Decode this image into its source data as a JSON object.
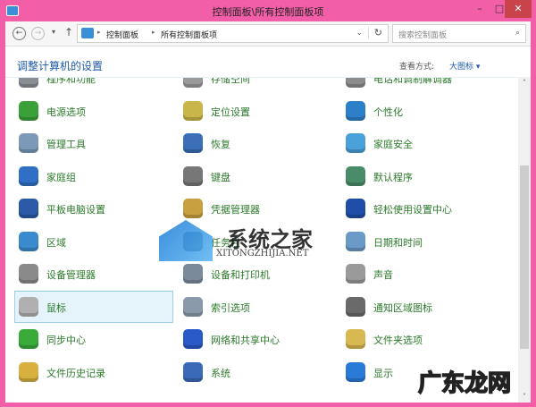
{
  "window": {
    "title": "控制面板\\所有控制面板项",
    "minimize": "–",
    "maximize": "□",
    "close": "✕"
  },
  "nav": {
    "back": "←",
    "forward": "→",
    "dropdown": "▾",
    "up": "↑",
    "breadcrumb": [
      "控制面板",
      "所有控制面板项"
    ],
    "sep": "▸",
    "addr_dropdown": "⌄",
    "refresh": "↻",
    "search_placeholder": "搜索控制面板",
    "search_icon": "⌕"
  },
  "header": {
    "title": "调整计算机的设置",
    "view_by_label": "查看方式:",
    "view_by_value": "大图标 ▾"
  },
  "items": [
    {
      "label": "程序和功能",
      "color": "#8a8f96"
    },
    {
      "label": "存储空间",
      "color": "#9a9a9a"
    },
    {
      "label": "电话和调制解调器",
      "color": "#8c8c8c"
    },
    {
      "label": "电源选项",
      "color": "#3aa13a"
    },
    {
      "label": "定位设置",
      "color": "#c9b64a"
    },
    {
      "label": "个性化",
      "color": "#2e7fc9"
    },
    {
      "label": "管理工具",
      "color": "#7c9ab8"
    },
    {
      "label": "恢复",
      "color": "#3b6fb8"
    },
    {
      "label": "家庭安全",
      "color": "#4aa0d8"
    },
    {
      "label": "家庭组",
      "color": "#2f6fc6"
    },
    {
      "label": "键盘",
      "color": "#777777"
    },
    {
      "label": "默认程序",
      "color": "#4a8c6a"
    },
    {
      "label": "平板电脑设置",
      "color": "#2a5aa8"
    },
    {
      "label": "凭据管理器",
      "color": "#c8a040"
    },
    {
      "label": "轻松使用设置中心",
      "color": "#1e4ea8"
    },
    {
      "label": "区域",
      "color": "#3a8ad0"
    },
    {
      "label": "任务栏",
      "color": "#5a7a9a"
    },
    {
      "label": "日期和时间",
      "color": "#6a9ac8"
    },
    {
      "label": "设备管理器",
      "color": "#8a8a8a"
    },
    {
      "label": "设备和打印机",
      "color": "#7a8a9a"
    },
    {
      "label": "声音",
      "color": "#9a9a9a"
    },
    {
      "label": "鼠标",
      "color": "#b0b0b0",
      "selected": true
    },
    {
      "label": "索引选项",
      "color": "#8a9aaa"
    },
    {
      "label": "通知区域图标",
      "color": "#6a6a6a"
    },
    {
      "label": "同步中心",
      "color": "#3aaa3a"
    },
    {
      "label": "网络和共享中心",
      "color": "#2a5ac8"
    },
    {
      "label": "文件夹选项",
      "color": "#d8b850"
    },
    {
      "label": "文件历史记录",
      "color": "#d8b040"
    },
    {
      "label": "系统",
      "color": "#3a6ab8"
    },
    {
      "label": "显示",
      "color": "#2a7ad8"
    }
  ],
  "scroll": {
    "up": "˄",
    "down": "˅"
  },
  "watermarks": {
    "site1": "系统之家",
    "site1_url": "XITONGZHIJIA.NET",
    "site2": "广东龙网"
  }
}
